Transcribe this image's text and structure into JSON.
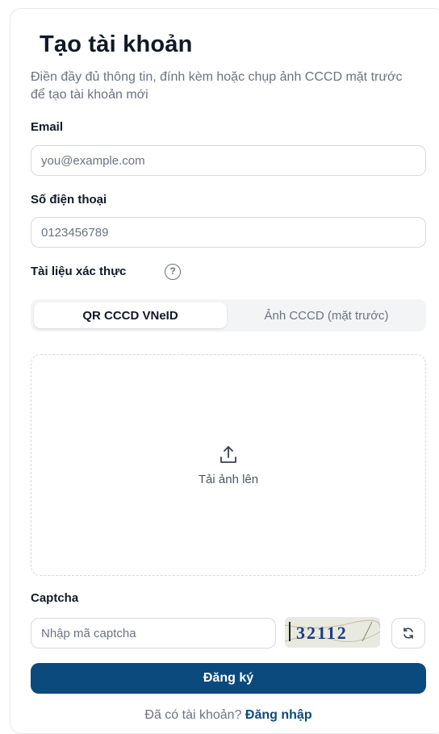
{
  "header": {
    "title": "Tạo tài khoản",
    "subtitle": "Điền đầy đủ thông tin, đính kèm hoặc chụp ảnh CCCD mặt trước để tạo tài khoản mới"
  },
  "email": {
    "label": "Email",
    "placeholder": "you@example.com",
    "value": ""
  },
  "phone": {
    "label": "Số điện thoại",
    "placeholder": "0123456789",
    "value": ""
  },
  "document": {
    "label": "Tài liệu xác thực",
    "help_icon": "question-circle-icon",
    "tabs": [
      {
        "label": "QR CCCD VNeID",
        "active": true
      },
      {
        "label": "Ảnh CCCD (mặt trước)",
        "active": false
      }
    ]
  },
  "upload": {
    "icon": "upload-icon",
    "label": "Tải ảnh lên"
  },
  "captcha": {
    "label": "Captcha",
    "placeholder": "Nhập mã captcha",
    "value": "",
    "image_text": "32112",
    "refresh_icon": "refresh-icon"
  },
  "actions": {
    "submit_label": "Đăng ký"
  },
  "footer": {
    "prompt": "Đã có tài khoản?",
    "login_link": "Đăng nhập"
  },
  "colors": {
    "primary": "#0b4a7d",
    "border": "#d6d9de",
    "muted_text": "#6b7280",
    "tab_bg": "#f3f4f6"
  }
}
